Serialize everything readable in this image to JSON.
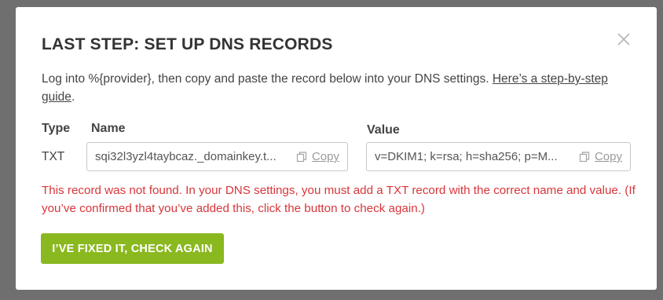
{
  "modal": {
    "title": "LAST STEP: SET UP DNS RECORDS",
    "intro_text": "Log into %{provider}, then copy and paste the record below into your DNS settings. ",
    "guide_link": "Here’s a step-by-step guide",
    "intro_end": ".",
    "close_icon": "close-icon"
  },
  "record": {
    "type_header": "Type",
    "name_header": "Name",
    "value_header": "Value",
    "type": "TXT",
    "name": "sqi32l3yzl4taybcaz._domainkey.t...",
    "value": "v=DKIM1; k=rsa; h=sha256; p=M...",
    "copy_label": "Copy",
    "copy_icon": "copy-icon"
  },
  "error_text": "This record was not found. In your DNS settings, you must add a TXT record with the correct name and value. (If you’ve confirmed that you’ve added this, click the button to check again.)",
  "check_button": "I’VE FIXED IT, CHECK AGAIN",
  "colors": {
    "overlay": "#6f6f6f",
    "error": "#d8363a",
    "button": "#8ab81f"
  }
}
